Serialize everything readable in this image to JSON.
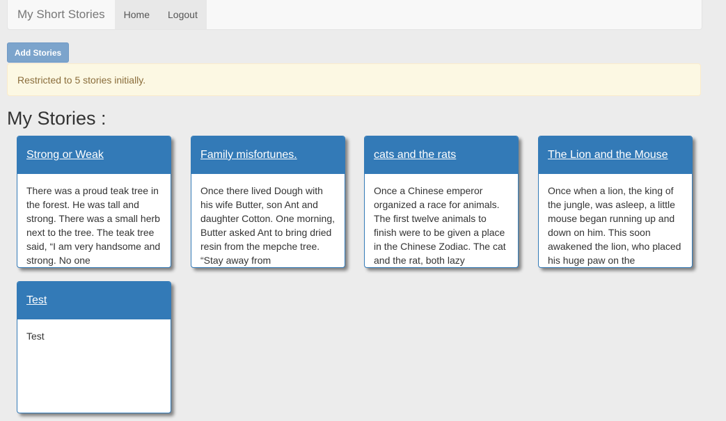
{
  "navbar": {
    "brand": "My Short Stories",
    "links": [
      "Home",
      "Logout"
    ]
  },
  "add_button": "Add Stories",
  "alert": "Restricted to 5 stories initially.",
  "section_title": "My Stories :",
  "stories": [
    {
      "title": "Strong or Weak",
      "body": "There was a proud teak tree in the forest. He was tall and strong. There was a small herb next to the tree. The teak tree said, “I am very handsome and strong. No one"
    },
    {
      "title": "Family misfortunes.",
      "body": "Once there lived Dough with his wife Butter, son Ant and daughter Cotton. One morning, Butter asked Ant to bring dried resin from the mepche tree. “Stay away from"
    },
    {
      "title": "cats and the rats",
      "body": "Once a Chinese emperor organized a race for animals. The first twelve animals to finish were to be given a place in the Chinese Zodiac. The cat and the rat, both lazy"
    },
    {
      "title": "The Lion and the Mouse",
      "body": "Once when a lion, the king of the jungle, was asleep, a little mouse began running up and down on him. This soon awakened the lion, who placed his huge paw on the"
    },
    {
      "title": "Test",
      "body": "Test"
    }
  ],
  "colors": {
    "primary": "#337ab7",
    "alert_bg": "#fcf8e3",
    "alert_text": "#8a6d3b",
    "page_bg": "#ececec"
  }
}
